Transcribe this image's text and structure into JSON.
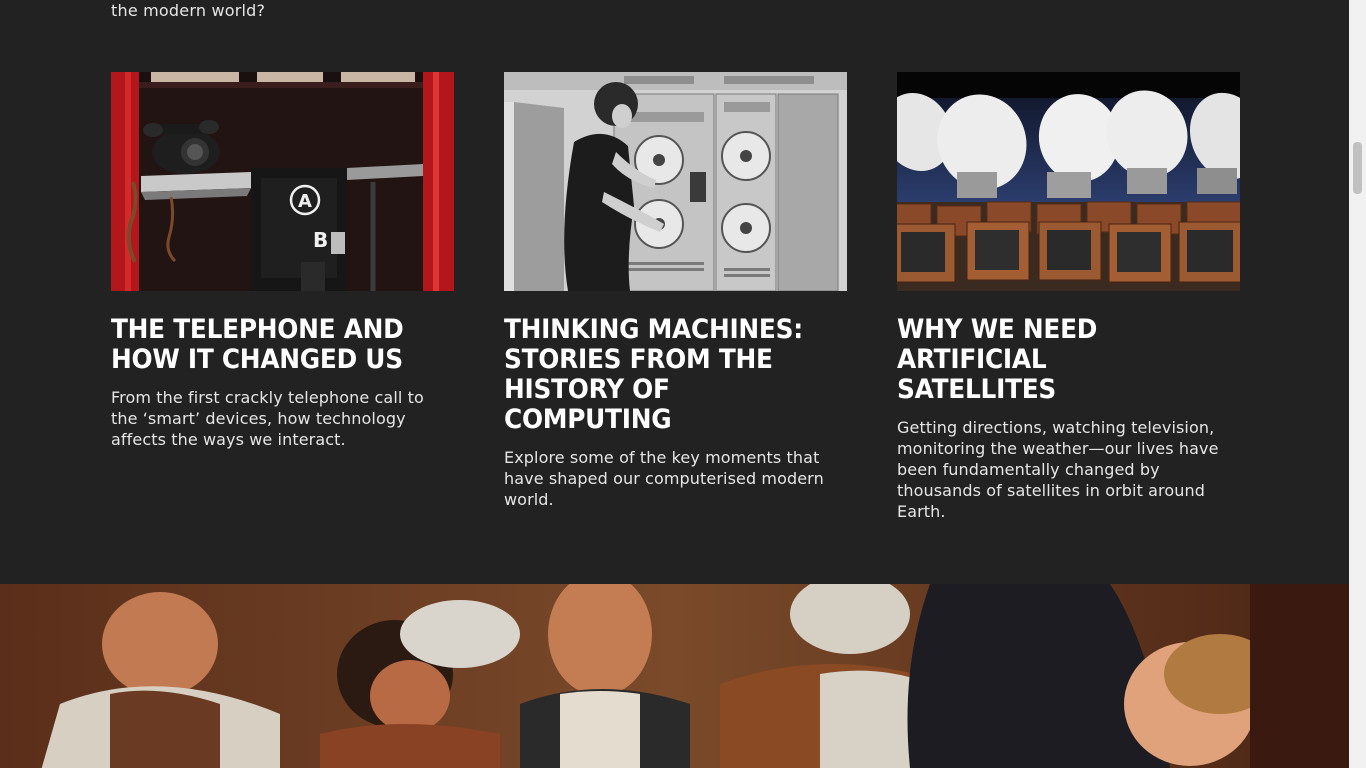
{
  "intro": {
    "tail_text": "the modern world?"
  },
  "cards": [
    {
      "title": "THE TELEPHONE AND HOW IT CHANGED US",
      "description": "From the first crackly telephone call to the ‘smart’ devices, how technology affects the ways we interact.",
      "image_subject": "red telephone box with A and B coin box"
    },
    {
      "title": "THINKING MACHINES: STORIES FROM THE HISTORY OF COMPUTING",
      "description": "Explore some of the key moments that have shaped our computerised modern world.",
      "image_subject": "woman operating reel-to-reel tape computer"
    },
    {
      "title": "WHY WE NEED ARTIFICIAL SATELLITES",
      "description": "Getting directions, watching television, monitoring the weather—our lives have been fundamentally changed by thousands of satellites in orbit around Earth.",
      "image_subject": "satellite dishes above rows of vintage televisions"
    }
  ],
  "banner": {
    "image_subject": "old oil painting of figures gathered around a table"
  },
  "colors": {
    "background": "#222222",
    "text": "#e6e6e6",
    "title": "#ffffff",
    "scrollbar_track": "#f1f1f1",
    "scrollbar_thumb": "#c1c1c1"
  }
}
